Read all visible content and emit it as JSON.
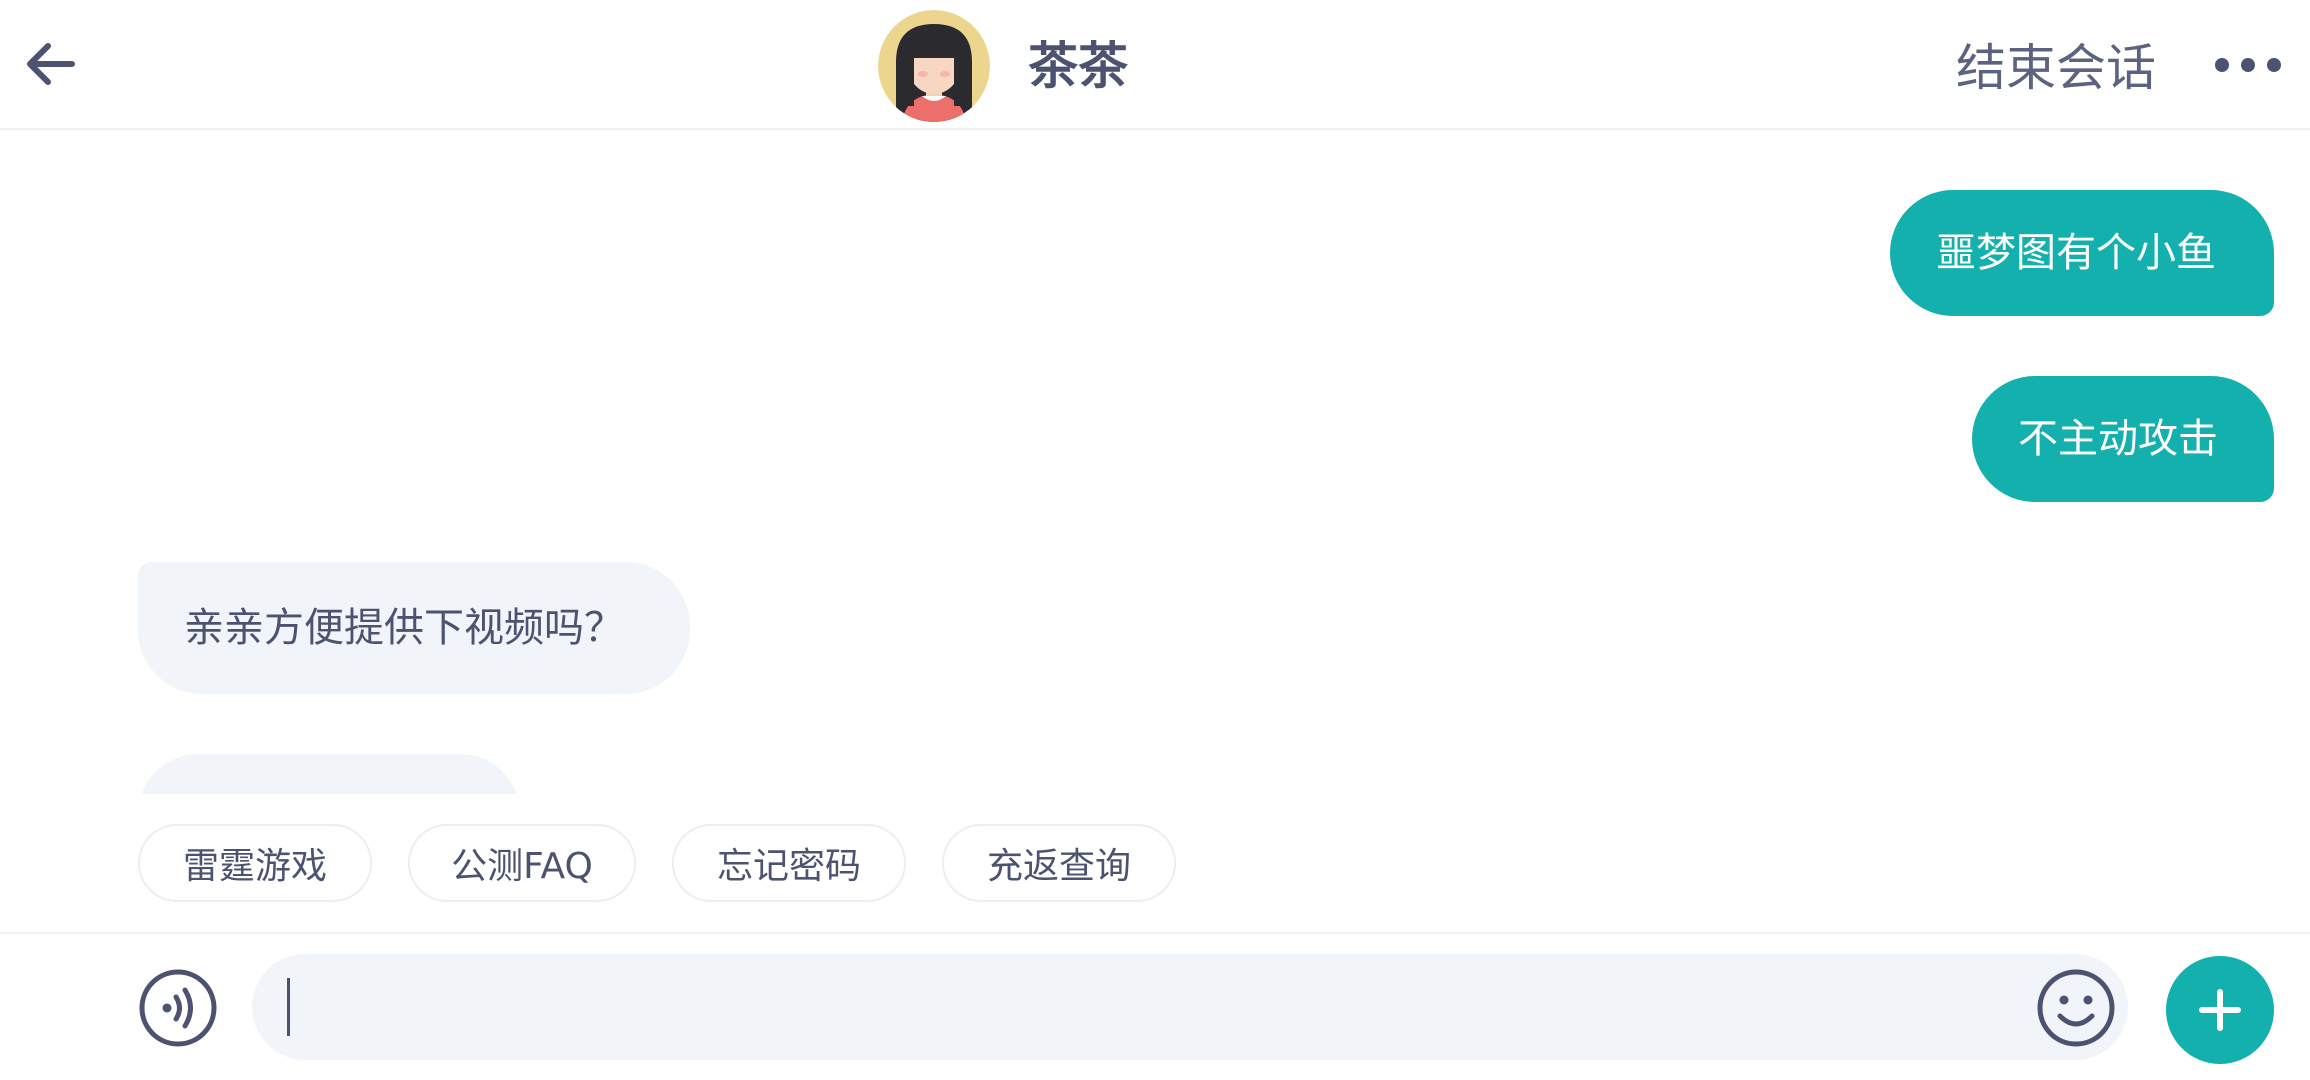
{
  "header": {
    "back_icon": "arrow-left-icon",
    "contact_name": "茶茶",
    "end_chat_label": "结束会话",
    "more_icon": "more-dots-icon"
  },
  "messages": [
    {
      "direction": "out",
      "text": "噩梦图有个小鱼"
    },
    {
      "direction": "out",
      "text": "不主动攻击"
    },
    {
      "direction": "in",
      "text": "亲亲方便提供下视频吗？"
    },
    {
      "direction": "in",
      "text": ""
    }
  ],
  "quick_replies": [
    "雷霆游戏",
    "公测FAQ",
    "忘记密码",
    "充返查询"
  ],
  "input": {
    "value": "",
    "placeholder": "",
    "voice_icon": "voice-icon",
    "emoji_icon": "emoji-icon",
    "plus_icon": "plus-icon"
  },
  "colors": {
    "accent": "#13b0ad",
    "text": "#4b5371",
    "incoming_bubble": "#f1f4f8",
    "background": "#ffffff"
  }
}
